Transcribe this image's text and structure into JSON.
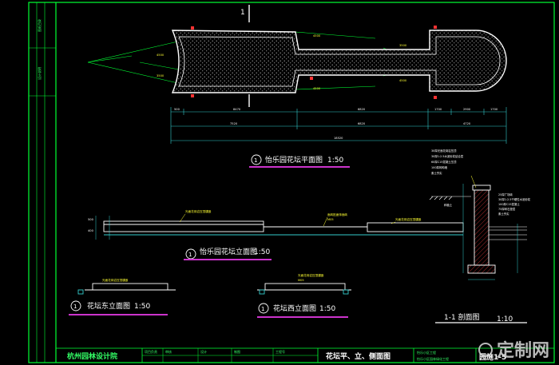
{
  "section_marker": "1",
  "plan_view": {
    "circle_no": "1",
    "title": "怡乐园花坛平面图",
    "scale": "1:50",
    "dims_row1": [
      "500",
      "8470",
      "",
      "6820",
      "1700",
      "2900",
      "1700"
    ],
    "dims_row2": [
      "7520",
      "6820",
      "4720"
    ],
    "dims_total": "18520",
    "callouts": [
      "4500",
      "3500",
      "4500",
      "4500",
      "3500",
      "4500"
    ]
  },
  "elevation_south": {
    "circle_no": "1",
    "title": "怡乐园花坛立面图",
    "scale": "1:50",
    "notes": [
      "光面花岗岩压顶镶嵌",
      "面砖贴面饰面砖",
      "光面花岗岩压顶",
      "光面花岗岩压顶镶嵌"
    ],
    "mark": "M05",
    "dims": [
      "500",
      "400"
    ]
  },
  "elevation_east": {
    "circle_no": "1",
    "title": "花坛东立面图",
    "scale": "1:50",
    "note": "光面花岗岩压顶镶嵌"
  },
  "elevation_west": {
    "circle_no": "1",
    "title": "花坛西立面图",
    "scale": "1:50",
    "note": "光面花岗岩压顶镶嵌",
    "mark": "M05"
  },
  "section_view": {
    "title": "1-1 剖面图",
    "scale": "1:10",
    "label_left": "种植土",
    "notes_top": [
      "30厚光面花岗岩压顶",
      "30厚1:2.5水泥砂浆结合层",
      "60厚C15混凝土压顶",
      "100厚砖砌墙",
      "素土夯实"
    ],
    "notes_right": [
      "25厚广场砖",
      "30厚1:2.5干硬性水泥砂浆",
      "100厚C15混凝土",
      "75厚碎石垫层",
      "素土夯实"
    ]
  },
  "title_block": {
    "company": "杭州园林设计院",
    "fields": [
      "项目负责",
      "审核",
      "设计",
      "制图",
      "工程号"
    ],
    "drawing_title": "花坛平、立、侧面图",
    "project": "怡乐小区园林绿化工程",
    "project_label": "怡乐小区工程",
    "sheet_no": "园施1-5"
  },
  "side_strip": [
    "图纸目录",
    "设计说明"
  ],
  "watermark": "定制网",
  "colors": {
    "frame": "#00ff33",
    "line": "#ffffff",
    "accent_underline": "#cc33cc",
    "dim": "#33ff66",
    "cyan": "#33cccc",
    "yellow": "#ffff33",
    "red": "#ff3333"
  }
}
